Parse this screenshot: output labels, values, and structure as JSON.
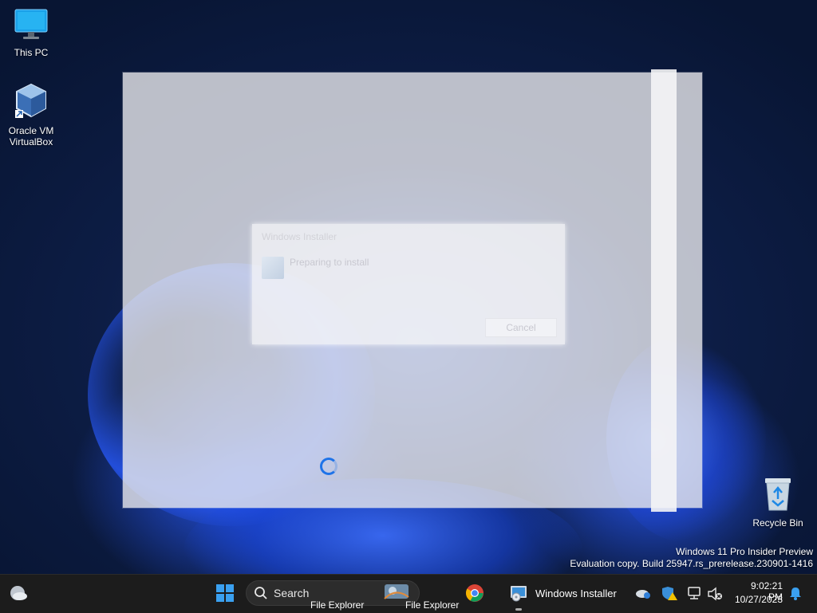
{
  "desktop": {
    "icons": [
      {
        "label": "This PC"
      },
      {
        "label": "Oracle VM VirtualBox"
      },
      {
        "label": "Recycle Bin"
      }
    ]
  },
  "installer": {
    "title": "Windows Installer",
    "status": "Preparing to install",
    "cancel_label": "Cancel"
  },
  "watermark": {
    "line1": "Windows 11 Pro Insider Preview",
    "line2": "Evaluation copy. Build 25947.rs_prerelease.230901-1416"
  },
  "taskbar": {
    "search_label": "Search",
    "file_explorer_label_1": "File Explorer",
    "file_explorer_label_2": "File Explorer",
    "installer_label": "Windows Installer",
    "time": "9:02:21 PM",
    "date": "10/27/2023"
  },
  "colors": {
    "accent": "#1e73e8",
    "taskbar": "#1c1c1c"
  }
}
